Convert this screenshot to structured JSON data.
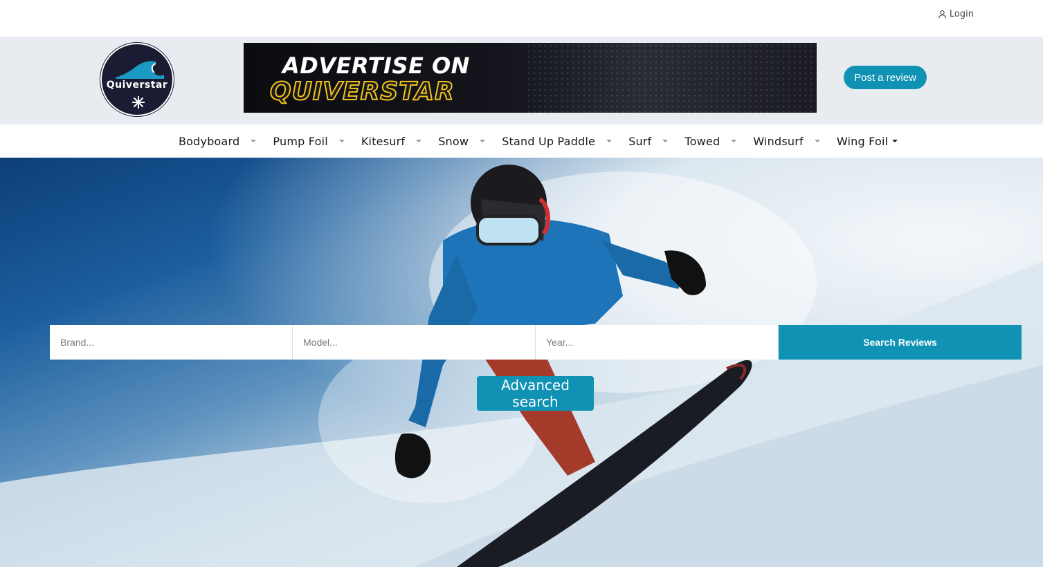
{
  "topbar": {
    "login_label": "Login",
    "login_icon": "user-icon"
  },
  "header": {
    "logo_text": "Quiverstar",
    "banner": {
      "line1": "ADVERTISE ON",
      "line2": "QUIVERSTAR"
    },
    "post_review_label": "Post a review"
  },
  "nav": {
    "items": [
      {
        "label": "Bodyboard"
      },
      {
        "label": "Pump Foil"
      },
      {
        "label": "Kitesurf"
      },
      {
        "label": "Snow"
      },
      {
        "label": "Stand Up Paddle"
      },
      {
        "label": "Surf"
      },
      {
        "label": "Towed"
      },
      {
        "label": "Windsurf"
      },
      {
        "label": "Wing Foil"
      }
    ]
  },
  "search": {
    "brand_placeholder": "Brand...",
    "model_placeholder": "Model...",
    "year_placeholder": "Year...",
    "search_button_label": "Search Reviews",
    "advanced_label": "Advanced search"
  },
  "colors": {
    "accent": "#0f92b4",
    "dark": "#1a1c33",
    "banner_yellow": "#f2c21b"
  }
}
